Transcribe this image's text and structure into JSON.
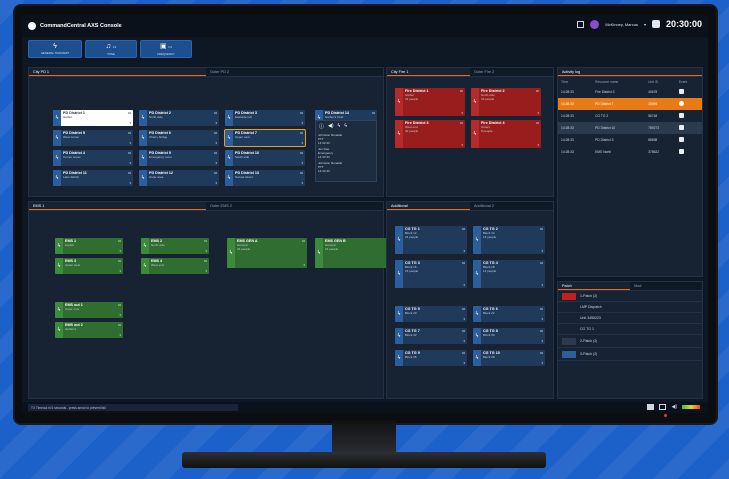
{
  "app": {
    "title": "CommandCentral AXS Console",
    "user": "McKinney, Marcus",
    "clock": "20:30:00"
  },
  "toolbar": [
    {
      "icon": "lightning-icon",
      "label": "GENERAL TRANSMIT",
      "value": ""
    },
    {
      "icon": "music-note-icon",
      "label": "TONE",
      "value": "12"
    },
    {
      "icon": "radio-icon",
      "label": "FREQUENCY",
      "value": "F1"
    }
  ],
  "panels": {
    "pd": {
      "tabs": [
        "City PD 1",
        "Outer PD 2"
      ]
    },
    "fire": {
      "tabs": [
        "City Fire 1",
        "Outer Fire 2"
      ]
    },
    "log": {
      "title": "Activity log",
      "columns": [
        "Time",
        "Resource name",
        "Unit ID",
        "Event"
      ],
      "rows": [
        {
          "time": "14:28:33",
          "name": "Fire District 3",
          "id": "40678"
        },
        {
          "time": "14:28:33",
          "name": "PD District 7",
          "id": "10494"
        },
        {
          "time": "14:28:33",
          "name": "CG TG 2",
          "id": "56748"
        },
        {
          "time": "14:28:33",
          "name": "PD District 10",
          "id": "789273"
        },
        {
          "time": "14:28:33",
          "name": "PD District 3",
          "id": "88698"
        },
        {
          "time": "14:28:33",
          "name": "EMS North",
          "id": "378622"
        }
      ]
    },
    "ems": {
      "tabs": [
        "EMS 1",
        "Outer EMS 2"
      ]
    },
    "additional": {
      "tabs": [
        "Additional",
        "Additional 2"
      ]
    },
    "patch": {
      "tabs": [
        "Patch",
        "Mod"
      ]
    }
  },
  "pd_cards": [
    {
      "t": "PD District 1",
      "s": "Harbor",
      "n": "04",
      "style": "sel"
    },
    {
      "t": "PD District 2",
      "s": "North side",
      "n": "04",
      "style": "blue"
    },
    {
      "t": "PD District 3",
      "s": "Eastside exit",
      "n": "04",
      "style": "blue"
    },
    {
      "t": "PD District 14",
      "s": "Harbor's Club",
      "n": "04",
      "style": "blue"
    },
    {
      "t": "PD District 5",
      "s": "West corner",
      "n": "04",
      "style": "blue"
    },
    {
      "t": "PD District 6",
      "s": "Cherry bridge",
      "n": "04",
      "style": "blue"
    },
    {
      "t": "PD District 7",
      "s": "Upper east",
      "n": "04",
      "style": "hl"
    },
    {
      "t": "PD District 4",
      "s": "Corner street",
      "n": "04",
      "style": "blue"
    },
    {
      "t": "PD District 9",
      "s": "Emergency room",
      "n": "04",
      "style": "blue"
    },
    {
      "t": "PD District 10",
      "s": "South side",
      "n": "04",
      "style": "blue"
    },
    {
      "t": "PD District 11",
      "s": "Lake district",
      "n": "04",
      "style": "blue"
    },
    {
      "t": "PD District 12",
      "s": "Outer area",
      "n": "04",
      "style": "blue"
    },
    {
      "t": "PD District 13",
      "s": "Sunset street",
      "n": "04",
      "style": "blue"
    }
  ],
  "popup": {
    "items": [
      {
        "a": "Johnston Ronaldo",
        "b": "PTT",
        "c": "14:32:33"
      },
      {
        "a": "Jon Doe",
        "b": "Emergency",
        "c": "14:32:33"
      },
      {
        "a": "Johnston Ronaldo",
        "b": "PTT",
        "c": "14:32:33"
      }
    ]
  },
  "fire_cards": [
    {
      "t": "Fire District 1",
      "s": "Harbor",
      "p": "24 people",
      "n": "02"
    },
    {
      "t": "Fire District 2",
      "s": "North side",
      "p": "16 people",
      "n": "02"
    },
    {
      "t": "Fire District 3",
      "s": "West end",
      "p": "40 people",
      "n": "04"
    },
    {
      "t": "Fire District 4",
      "s": "Outers",
      "p": "8 people",
      "n": "04"
    }
  ],
  "ems_cards": [
    {
      "t": "EMS 1",
      "s": "Harbor",
      "n": "04"
    },
    {
      "t": "EMS 2",
      "s": "North side",
      "n": "04"
    },
    {
      "t": "EMS 3",
      "s": "Upper west",
      "n": "04"
    },
    {
      "t": "EMS 4",
      "s": "West end",
      "n": "04"
    },
    {
      "t": "EMS GEN A",
      "s": "General",
      "p": "24 people",
      "n": "04"
    },
    {
      "t": "EMS GEN B",
      "s": "General",
      "p": "16 people",
      "n": "04"
    },
    {
      "t": "EMS out 1",
      "s": "Outer rims",
      "n": "04"
    },
    {
      "t": "EMS out 2",
      "s": "Harbor's",
      "n": "04"
    }
  ],
  "tg_cards": [
    {
      "t": "CG TG 1",
      "s": "Block 12",
      "p": "24 people",
      "n": "04"
    },
    {
      "t": "CG TG 2",
      "s": "Block 14",
      "p": "15 people",
      "n": "04"
    },
    {
      "t": "CG TG 3",
      "s": "Block 16",
      "p": "16 people",
      "n": "04"
    },
    {
      "t": "CG TG 4",
      "s": "Block 18",
      "p": "12 people",
      "n": "04"
    },
    {
      "t": "CG TG 5",
      "s": "Block 20",
      "n": "04"
    },
    {
      "t": "CG TG 6",
      "s": "Block 22",
      "n": "04"
    },
    {
      "t": "CG TG 7",
      "s": "Block 32",
      "n": "04"
    },
    {
      "t": "CG TG 8",
      "s": "Block 34",
      "n": "04"
    },
    {
      "t": "CG TG 9",
      "s": "Block 36",
      "n": "04"
    },
    {
      "t": "CG TG 10",
      "s": "Block 38",
      "n": "04"
    }
  ],
  "patch": [
    {
      "label": "1-Patch (2)"
    },
    {
      "label": "LMP Dispatch"
    },
    {
      "label": "Unit 3455223"
    },
    {
      "label": "CG TG 1"
    },
    {
      "label": "2-Patch (2)"
    },
    {
      "label": "3-Patch (2)"
    }
  ],
  "status": {
    "text": "TX Timeout in 5 seconds - press arrow to prevent fail"
  }
}
